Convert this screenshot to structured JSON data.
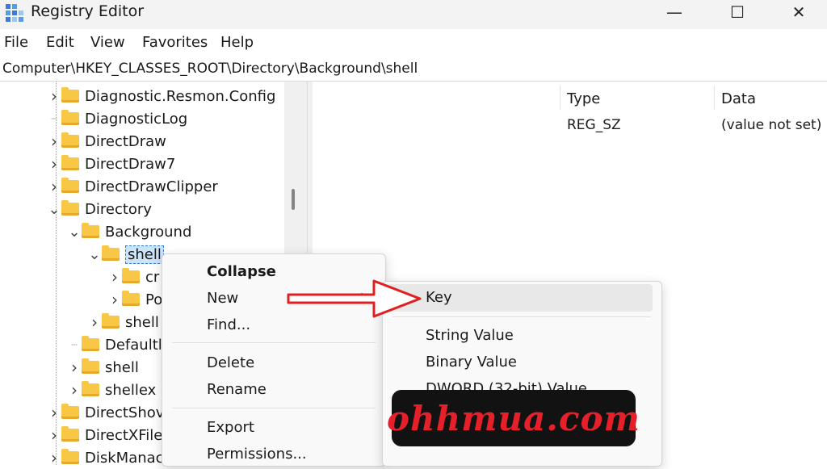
{
  "window": {
    "title": "Registry Editor",
    "minimize_glyph": "—",
    "maximize_glyph": "☐",
    "close_glyph": "✕"
  },
  "menu": [
    "File",
    "Edit",
    "View",
    "Favorites",
    "Help"
  ],
  "address": "Computer\\HKEY_CLASSES_ROOT\\Directory\\Background\\shell",
  "tree": {
    "rows": [
      {
        "label": "Diagnostic.Resmon.Config",
        "chevron": ">"
      },
      {
        "label": "DiagnosticLog",
        "chevron": ""
      },
      {
        "label": "DirectDraw",
        "chevron": ">"
      },
      {
        "label": "DirectDraw7",
        "chevron": ">"
      },
      {
        "label": "DirectDrawClipper",
        "chevron": ">"
      },
      {
        "label": "Directory",
        "chevron": "v"
      },
      {
        "label": "Background",
        "chevron": "v"
      },
      {
        "label": "shell",
        "chevron": "v"
      },
      {
        "label": "cr",
        "chevron": ">"
      },
      {
        "label": "Po",
        "chevron": ">"
      },
      {
        "label": "shell",
        "chevron": ">"
      },
      {
        "label": "Defaultl",
        "chevron": ""
      },
      {
        "label": "shell",
        "chevron": ">"
      },
      {
        "label": "shellex",
        "chevron": ">"
      },
      {
        "label": "DirectShov",
        "chevron": ">"
      },
      {
        "label": "DirectXFile",
        "chevron": ">"
      },
      {
        "label": "DiskManac",
        "chevron": ">"
      }
    ]
  },
  "list": {
    "col_type": "Type",
    "col_data": "Data",
    "row_type": "REG_SZ",
    "row_data": "(value not set)"
  },
  "context_menu": {
    "collapse": "Collapse",
    "new": "New",
    "new_arrow": ">",
    "find": "Find...",
    "delete": "Delete",
    "rename": "Rename",
    "export": "Export",
    "permissions": "Permissions..."
  },
  "submenu": {
    "key": "Key",
    "string_value": "String Value",
    "binary_value": "Binary Value",
    "dword_value": "DWORD (32-bit) Value"
  },
  "watermark": "ohhmua.com",
  "colors": {
    "arrow_red": "#e02020",
    "folder_yellow": "#f8c746",
    "watermark_red": "#e5202a"
  }
}
